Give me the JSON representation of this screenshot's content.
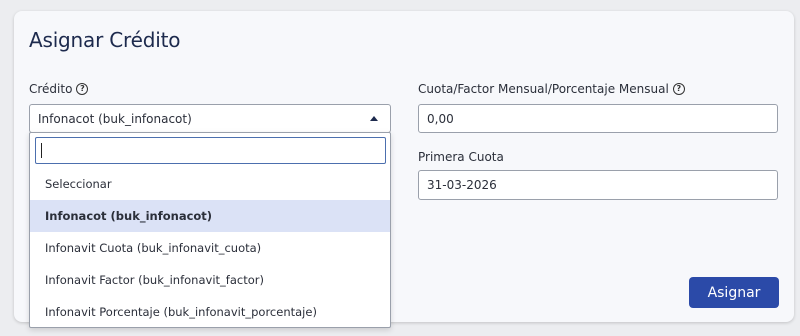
{
  "modal": {
    "title": "Asignar Crédito",
    "primary_button": "Asignar"
  },
  "fields": {
    "credito": {
      "label": "Crédito",
      "value": "Infonacot (buk_infonacot)"
    },
    "cuota": {
      "label": "Cuota/Factor Mensual/Porcentaje Mensual",
      "value": "0,00"
    },
    "primera_cuota": {
      "label": "Primera Cuota",
      "value": "31-03-2026"
    }
  },
  "dropdown": {
    "search_value": "",
    "options": [
      {
        "label": "Seleccionar",
        "selected": false
      },
      {
        "label": "Infonacot (buk_infonacot)",
        "selected": true
      },
      {
        "label": "Infonavit Cuota (buk_infonavit_cuota)",
        "selected": false
      },
      {
        "label": "Infonavit Factor (buk_infonavit_factor)",
        "selected": false
      },
      {
        "label": "Infonavit Porcentaje (buk_infonavit_porcentaje)",
        "selected": false
      }
    ]
  },
  "icons": {
    "help": "help-circle-icon",
    "caret": "caret-up-icon"
  },
  "colors": {
    "primary": "#2b4aa8",
    "title": "#1d2a4d",
    "selected_bg": "#dbe2f6"
  }
}
